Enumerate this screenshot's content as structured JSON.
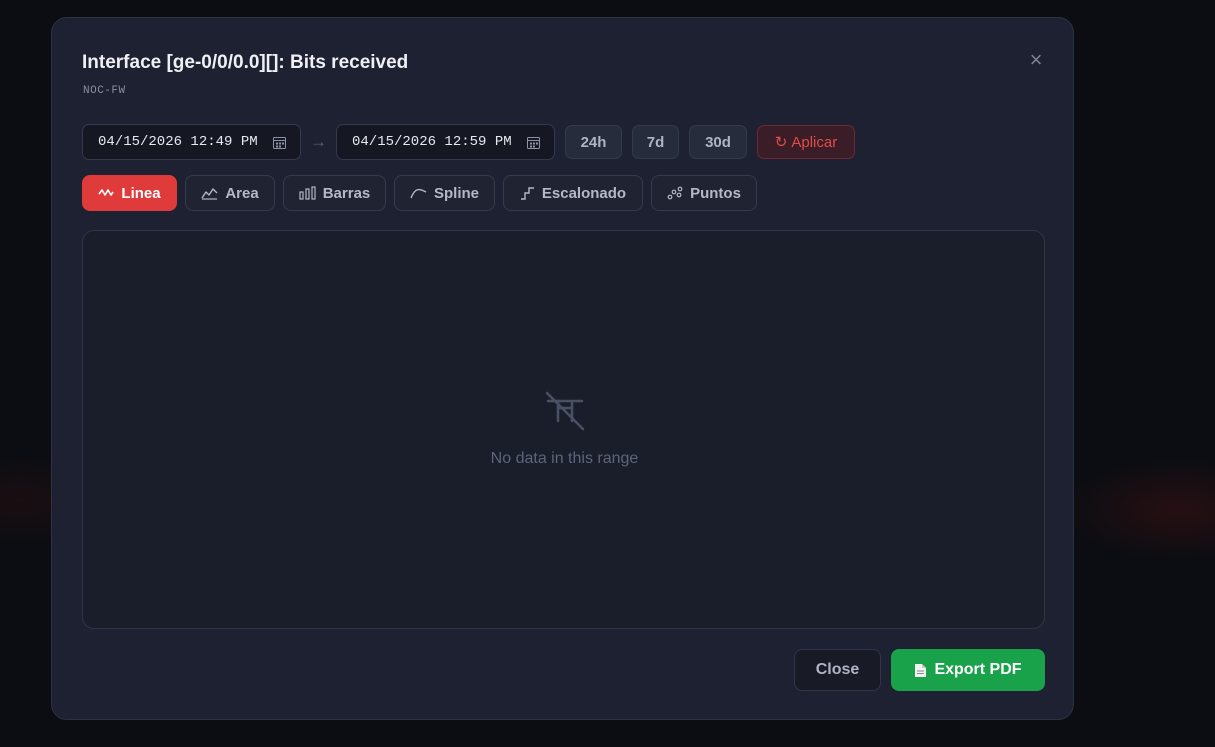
{
  "modal": {
    "title": "Interface [ge-0/0/0.0][]: Bits received",
    "subtitle": "NOC-FW",
    "close_glyph": "×"
  },
  "range": {
    "from_value": "04/15/2026 12:49 PM",
    "to_value": "04/15/2026 12:59 PM",
    "separator": "→",
    "presets": [
      "24h",
      "7d",
      "30d"
    ],
    "apply_icon": "↻",
    "apply_label": "Aplicar"
  },
  "chart_types": [
    {
      "label": "Linea",
      "icon": "line-chart-icon",
      "active": true
    },
    {
      "label": "Area",
      "icon": "area-chart-icon",
      "active": false
    },
    {
      "label": "Barras",
      "icon": "bar-chart-icon",
      "active": false
    },
    {
      "label": "Spline",
      "icon": "spline-chart-icon",
      "active": false
    },
    {
      "label": "Escalonado",
      "icon": "step-chart-icon",
      "active": false
    },
    {
      "label": "Puntos",
      "icon": "scatter-chart-icon",
      "active": false
    }
  ],
  "chart": {
    "empty_icon": "chart-off-icon",
    "empty_message": "No data in this range"
  },
  "footer": {
    "close_label": "Close",
    "export_icon": "document-icon",
    "export_label": "Export PDF"
  },
  "colors": {
    "accent_red": "#e03b3b",
    "export_green": "#19a24a",
    "modal_bg": "#1d2131"
  }
}
